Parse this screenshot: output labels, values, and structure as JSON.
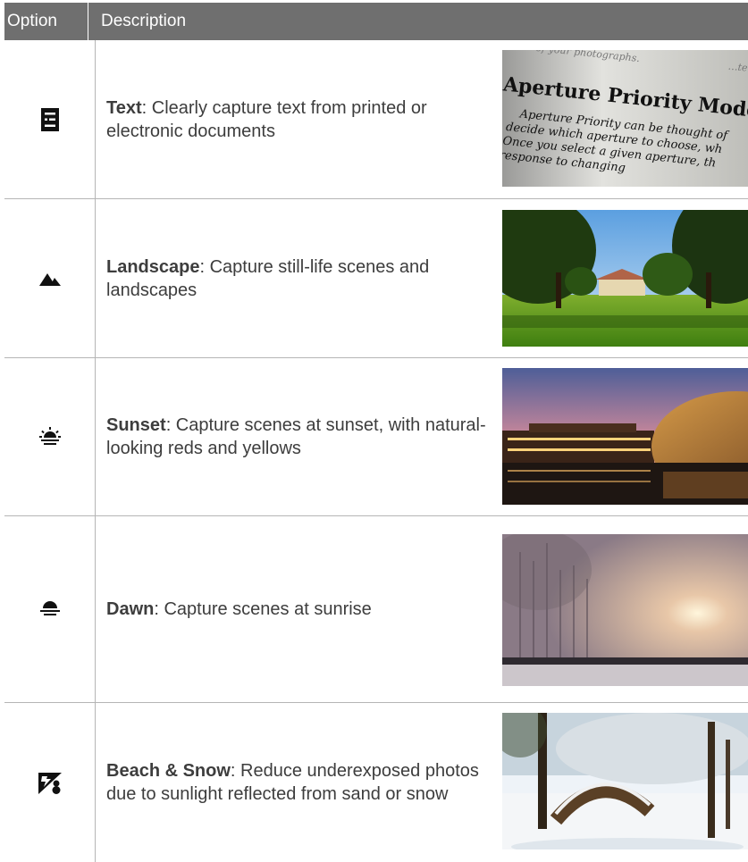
{
  "header": {
    "option_label": "Option",
    "description_label": "Description"
  },
  "rows": [
    {
      "title": "Text",
      "text": ": Clearly capture text from printed or electronic documents",
      "icon": "text-mode-icon",
      "photo": "aperture-priority-page-photo",
      "photo_text": {
        "line0": "of your photographs.",
        "heading": "Aperture Priority Mode",
        "line1": "Aperture Priority can be thought of",
        "line2": "decide which aperture to choose, wh",
        "line3": "Once you select a given aperture, th",
        "line4": "response to changing",
        "corner": "…ter"
      }
    },
    {
      "title": "Landscape",
      "text": ": Capture still-life scenes and landscapes",
      "icon": "landscape-mode-icon",
      "photo": "park-landscape-photo"
    },
    {
      "title": "Sunset",
      "text": ": Capture scenes at sunset, with natural-looking reds and yellows",
      "icon": "sunset-mode-icon",
      "photo": "sunset-building-photo"
    },
    {
      "title": "Dawn",
      "text": ": Capture scenes at sunrise",
      "icon": "dawn-mode-icon",
      "photo": "foggy-dawn-photo"
    },
    {
      "title": "Beach & Snow",
      "text": ": Reduce underexposed photos due to sunlight reflected from sand or snow",
      "icon": "beach-snow-mode-icon",
      "photo": "snowy-park-photo"
    }
  ]
}
